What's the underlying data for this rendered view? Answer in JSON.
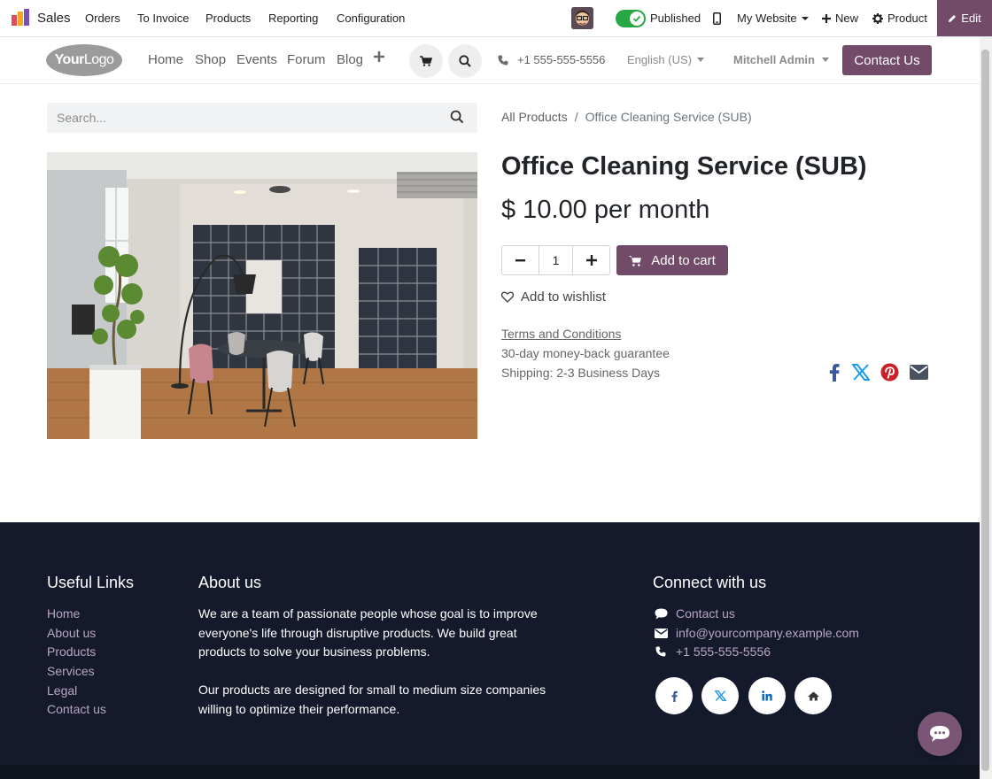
{
  "admin_bar": {
    "app_name": "Sales",
    "menu": [
      "Orders",
      "To Invoice",
      "Products",
      "Reporting",
      "Configuration"
    ],
    "published_label": "Published",
    "website_label": "My Website",
    "new_label": "New",
    "product_label": "Product",
    "edit_label": "Edit"
  },
  "header": {
    "logo_bold": "Your",
    "logo_light": "Logo",
    "nav": [
      "Home",
      "Shop",
      "Events",
      "Forum",
      "Blog"
    ],
    "phone": "+1 555-555-5556",
    "language": "English (US)",
    "user": "Mitchell Admin",
    "contact_label": "Contact Us"
  },
  "search": {
    "placeholder": "Search..."
  },
  "breadcrumb": {
    "parent": "All Products",
    "separator": "/",
    "current": "Office Cleaning Service (SUB)"
  },
  "product": {
    "title": "Office Cleaning Service (SUB)",
    "price": "$ 10.00 per month",
    "quantity": "1",
    "add_to_cart": "Add to cart",
    "wishlist": "Add to wishlist",
    "terms": "Terms and Conditions",
    "guarantee": "30-day money-back guarantee",
    "shipping": "Shipping: 2-3 Business Days"
  },
  "footer": {
    "useful_links_title": "Useful Links",
    "useful_links": [
      "Home",
      "About us",
      "Products",
      "Services",
      "Legal",
      "Contact us"
    ],
    "about_title": "About us",
    "about_p1": "We are a team of passionate people whose goal is to improve everyone's life through disruptive products. We build great products to solve your business problems.",
    "about_p2": "Our products are designed for small to medium size companies willing to optimize their performance.",
    "connect_title": "Connect with us",
    "connect": {
      "contact": "Contact us",
      "email": "info@yourcompany.example.com",
      "phone": "+1 555-555-5556"
    }
  },
  "colors": {
    "brand": "#714b67",
    "published_toggle": "#28a745",
    "footer_bg": "#141a2b",
    "footer_link": "#b8a7c4"
  },
  "icons": [
    "app-logo-icon",
    "check-icon",
    "mobile-icon",
    "plus-icon",
    "gear-icon",
    "pencil-icon",
    "cart-icon",
    "search-icon",
    "phone-icon",
    "minus-icon",
    "heart-icon",
    "facebook-icon",
    "x-twitter-icon",
    "pinterest-icon",
    "envelope-icon",
    "comment-icon",
    "linkedin-icon",
    "home-icon",
    "chat-icon"
  ]
}
